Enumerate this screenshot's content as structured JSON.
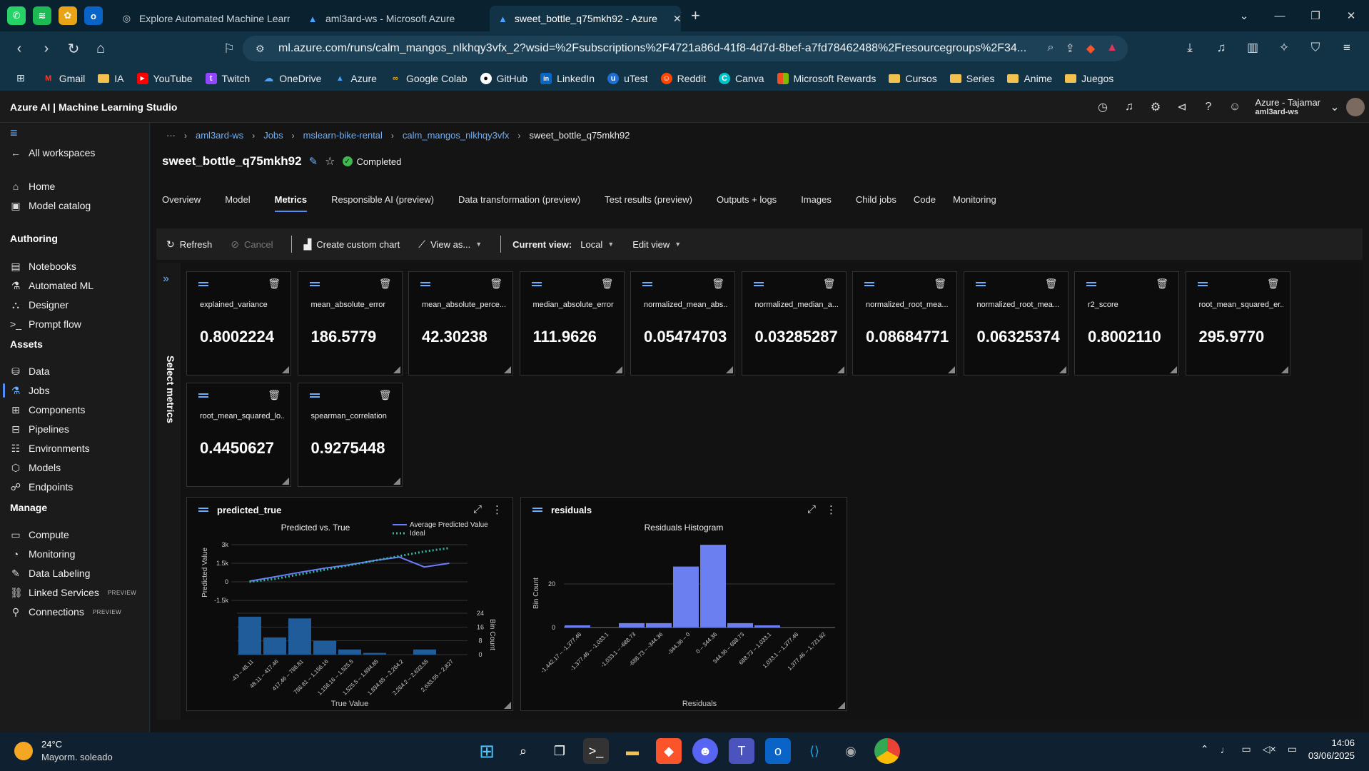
{
  "browser": {
    "tabs": [
      {
        "title": "Explore Automated Machine Learnin"
      },
      {
        "title": "aml3ard-ws - Microsoft Azure"
      },
      {
        "title": "sweet_bottle_q75mkh92 - Azure"
      }
    ],
    "url": "ml.azure.com/runs/calm_mangos_nlkhqy3vfx_2?wsid=%2Fsubscriptions%2F4721a86d-41f8-4d7d-8bef-a7fd78462488%2Fresourcegroups%2F34...",
    "bookmarks": [
      "Gmail",
      "IA",
      "YouTube",
      "Twitch",
      "OneDrive",
      "Azure",
      "Google Colab",
      "GitHub",
      "LinkedIn",
      "uTest",
      "Reddit",
      "Canva",
      "Microsoft Rewards",
      "Cursos",
      "Series",
      "Anime",
      "Juegos"
    ]
  },
  "app": {
    "title": "Azure AI | Machine Learning Studio",
    "account_name": "Azure - Tajamar",
    "account_ws": "aml3ard-ws"
  },
  "nav": {
    "all_workspaces": "All workspaces",
    "home": "Home",
    "model_catalog": "Model catalog",
    "authoring": "Authoring",
    "notebooks": "Notebooks",
    "automated_ml": "Automated ML",
    "designer": "Designer",
    "prompt_flow": "Prompt flow",
    "assets": "Assets",
    "data": "Data",
    "jobs": "Jobs",
    "components": "Components",
    "pipelines": "Pipelines",
    "environments": "Environments",
    "models": "Models",
    "endpoints": "Endpoints",
    "manage": "Manage",
    "compute": "Compute",
    "monitoring": "Monitoring",
    "data_labeling": "Data Labeling",
    "linked_services": "Linked Services",
    "connections": "Connections",
    "preview_tag": "PREVIEW"
  },
  "breadcrumb": [
    "aml3ard-ws",
    "Jobs",
    "mslearn-bike-rental",
    "calm_mangos_nlkhqy3vfx",
    "sweet_bottle_q75mkh92"
  ],
  "job": {
    "title": "sweet_bottle_q75mkh92",
    "status": "Completed"
  },
  "tabs": [
    "Overview",
    "Model",
    "Metrics",
    "Responsible AI (preview)",
    "Data transformation (preview)",
    "Test results (preview)",
    "Outputs + logs",
    "Images",
    "Child jobs",
    "Code",
    "Monitoring"
  ],
  "toolbar": {
    "refresh": "Refresh",
    "cancel": "Cancel",
    "create_chart": "Create custom chart",
    "view_as": "View as...",
    "current_view_label": "Current view:",
    "current_view_value": "Local",
    "edit_view": "Edit view"
  },
  "select_metrics": "Select metrics",
  "metrics": [
    {
      "name": "explained_variance",
      "value": "0.8002224"
    },
    {
      "name": "mean_absolute_error",
      "value": "186.5779"
    },
    {
      "name": "mean_absolute_perce...",
      "value": "42.30238"
    },
    {
      "name": "median_absolute_error",
      "value": "111.9626"
    },
    {
      "name": "normalized_mean_abs...",
      "value": "0.05474703"
    },
    {
      "name": "normalized_median_a...",
      "value": "0.03285287"
    },
    {
      "name": "normalized_root_mea...",
      "value": "0.08684771"
    },
    {
      "name": "normalized_root_mea...",
      "value": "0.06325374"
    },
    {
      "name": "r2_score",
      "value": "0.8002110"
    },
    {
      "name": "root_mean_squared_er...",
      "value": "295.9770"
    },
    {
      "name": "root_mean_squared_lo...",
      "value": "0.4450627"
    },
    {
      "name": "spearman_correlation",
      "value": "0.9275448"
    }
  ],
  "charts": {
    "predicted_true": {
      "card_title": "predicted_true"
    },
    "residuals": {
      "card_title": "residuals"
    }
  },
  "chart_data": [
    {
      "type": "line",
      "title": "Predicted vs. True",
      "xlabel": "True Value",
      "ylabel": "Predicted Value",
      "y2label": "Bin Count",
      "ylim": [
        -1500,
        3000
      ],
      "yticks": [
        "3k",
        "1.5k",
        "0",
        "-1.5k"
      ],
      "y2ticks": [
        "24",
        "16",
        "8",
        "0"
      ],
      "categories": [
        "-43 – 48.11",
        "48.11 – 417.46",
        "417.46 – 786.81",
        "786.81 – 1,156.16",
        "1,156.16 – 1,525.5",
        "1,525.5 – 1,894.85",
        "1,894.85 – 2,264.2",
        "2,264.2 – 2,633.55",
        "2,633.55 – 2,827"
      ],
      "series": [
        {
          "name": "Average Predicted Value",
          "values": [
            50,
            400,
            760,
            1100,
            1380,
            1720,
            2000,
            1200,
            1500
          ]
        },
        {
          "name": "Ideal",
          "values": [
            0,
            230,
            600,
            970,
            1340,
            1710,
            2080,
            2450,
            2730
          ]
        }
      ],
      "bin_counts": [
        22,
        10,
        21,
        8,
        3,
        1,
        0,
        3,
        0
      ]
    },
    {
      "type": "bar",
      "title": "Residuals Histogram",
      "xlabel": "Residuals",
      "ylabel": "Bin Count",
      "yticks": [
        "20",
        "0"
      ],
      "ylim": [
        0,
        40
      ],
      "categories": [
        "-1,442.17 – -1,377.46",
        "-1,377.46 – -1,033.1",
        "-1,033.1 – -688.73",
        "-688.73 – -344.36",
        "-344.36 – 0",
        "0 – 344.36",
        "344.36 – 688.73",
        "688.73 – 1,033.1",
        "1,033.1 – 1,377.46",
        "1,377.46 – 1,721.82"
      ],
      "values": [
        1,
        0,
        2,
        2,
        28,
        38,
        2,
        1,
        0,
        0
      ]
    }
  ],
  "taskbar": {
    "temp": "24°C",
    "weather": "Mayorm. soleado",
    "time": "14:06",
    "date": "03/06/2025"
  }
}
